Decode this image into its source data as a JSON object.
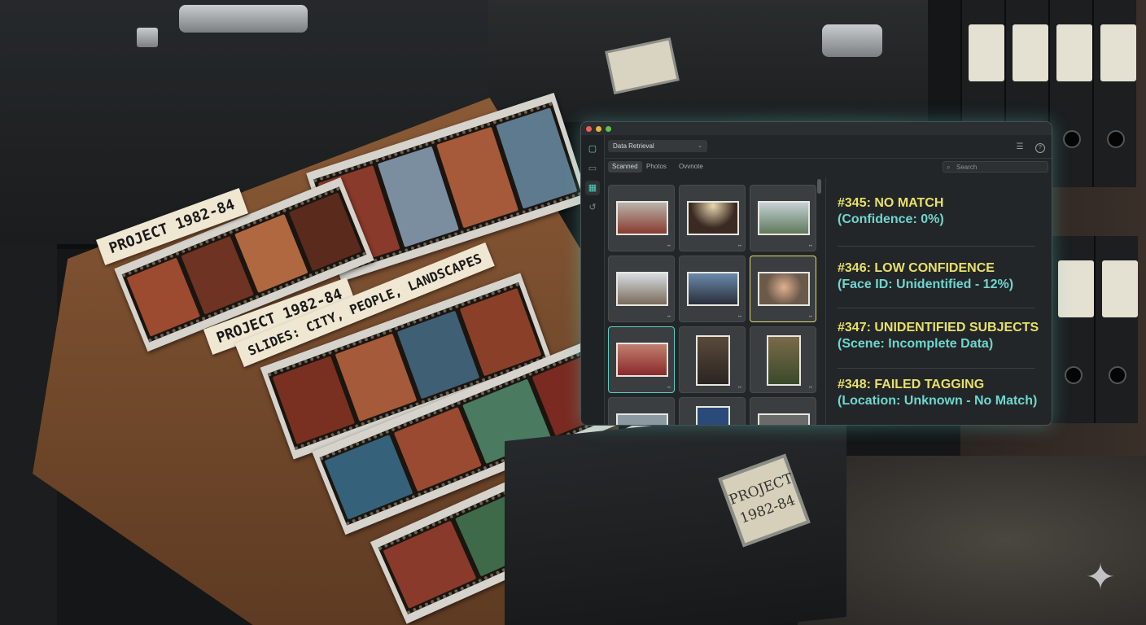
{
  "app": {
    "workspace": "Data Retrieval",
    "search_placeholder": "Search",
    "tabs": [
      {
        "label": "Scanned",
        "active": true
      },
      {
        "label": "Photos",
        "active": false
      },
      {
        "label": "Ovvnote",
        "active": false
      }
    ],
    "sidebar_icons": [
      "square-icon",
      "folder-icon",
      "table-icon",
      "history-icon"
    ],
    "toolbar_icons": [
      "filter-list-icon",
      "help-icon"
    ],
    "accent_colors": {
      "yellow": "#e8e06a",
      "teal": "#6fd6cf"
    }
  },
  "results": [
    {
      "title": "#345: NO MATCH",
      "detail": "(Confidence: 0%)"
    },
    {
      "title": "#346: LOW CONFIDENCE",
      "detail": "(Face ID: Unidentified - 12%)"
    },
    {
      "title": "#347: UNIDENTIFIED SUBJECTS",
      "detail": "(Scene: Incomplete Data)"
    },
    {
      "title": "#348: FAILED TAGGING",
      "detail": "(Location: Unknown - No Match)"
    }
  ],
  "scene": {
    "folder_labels": [
      "PROJECT 1982-84",
      "PROJECT 1982-84",
      "SLIDES: CITY, PEOPLE, LANDSCAPES"
    ],
    "drawer_plate": "PROJECT 1982-84"
  }
}
